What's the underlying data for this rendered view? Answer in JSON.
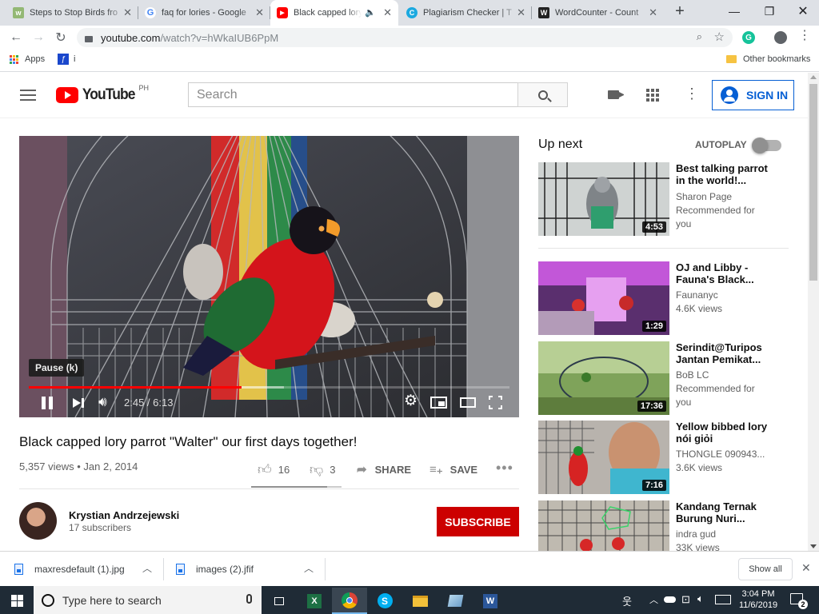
{
  "browser": {
    "tabs": [
      {
        "title": "Steps to Stop Birds fro",
        "favicon": "wikihow-icon",
        "active": false
      },
      {
        "title": "faq for lories - Google",
        "favicon": "google-icon",
        "active": false
      },
      {
        "title": "Black capped lory",
        "favicon": "youtube-icon",
        "active": true
      },
      {
        "title": "Plagiarism Checker | T",
        "favicon": "plagiarism-icon",
        "active": false
      },
      {
        "title": "WordCounter - Count",
        "favicon": "wordcounter-icon",
        "active": false
      }
    ],
    "url_host": "youtube.com",
    "url_path": "/watch?v=hWkaIUB6PpM",
    "bookmarks": {
      "apps_label": "Apps",
      "item2": "i",
      "other": "Other bookmarks"
    }
  },
  "youtube": {
    "logo_text": "YouTube",
    "region": "PH",
    "search_placeholder": "Search",
    "signin_label": "SIGN IN",
    "video": {
      "title": "Black capped lory parrot \"Walter\" our first days together!",
      "views_date": "5,357 views • Jan 2, 2014",
      "likes": "16",
      "dislikes": "3",
      "share_label": "SHARE",
      "save_label": "SAVE",
      "time": "2:45 / 6:13",
      "progress": 0.442,
      "buffered": 0.53,
      "tooltip": "Pause (k)"
    },
    "channel": {
      "name": "Krystian Andrzejewski",
      "subs": "17 subscribers",
      "subscribe_label": "SUBSCRIBE"
    },
    "upnext": {
      "label": "Up next",
      "autoplay_label": "AUTOPLAY"
    },
    "recommendations": [
      {
        "title": "Best talking parrot in the world!...",
        "channel": "Sharon Page",
        "meta": "Recommended for you",
        "duration": "4:53"
      },
      {
        "title": "OJ and Libby - Fauna's Black...",
        "channel": "Faunanyc",
        "meta": "4.6K views",
        "duration": "1:29"
      },
      {
        "title": "Serindit@Turipos Jantan Pemikat...",
        "channel": "BoB LC",
        "meta": "Recommended for you",
        "duration": "17:36"
      },
      {
        "title": "Yellow bibbed lory nói giỏi",
        "channel": "THONGLE 090943...",
        "meta": "3.6K views",
        "duration": "7:16"
      },
      {
        "title": "Kandang Ternak Burung Nuri...",
        "channel": "indra gud",
        "meta": "33K views",
        "duration": ""
      }
    ]
  },
  "downloads": {
    "items": [
      {
        "name": "maxresdefault (1).jpg"
      },
      {
        "name": "images (2).jfif"
      }
    ],
    "show_all": "Show all"
  },
  "taskbar": {
    "search_placeholder": "Type here to search",
    "time": "3:04 PM",
    "date": "11/6/2019",
    "notification_count": "2"
  },
  "colors": {
    "youtube_red": "#ff0000",
    "subscribe_red": "#cc0000",
    "link_blue": "#065fd4",
    "taskbar": "#1f2b36"
  }
}
